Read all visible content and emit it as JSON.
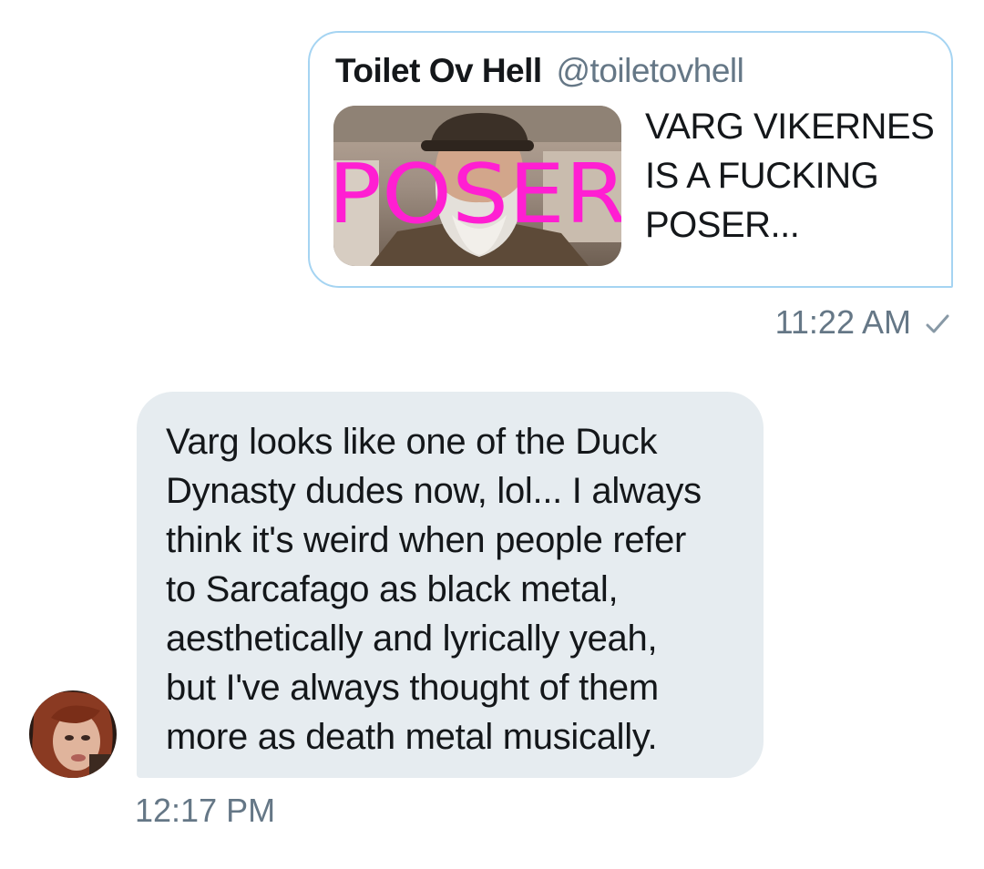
{
  "sent_message": {
    "tweet_card": {
      "author_name": "Toilet Ov Hell",
      "author_handle": "@toiletovhell",
      "thumbnail_overlay_text": "POSER",
      "text_lines": [
        "VARG VIKERNES",
        "IS A FUCKING",
        "POSER..."
      ]
    },
    "time": "11:22 AM",
    "status_icon": "checkmark-icon"
  },
  "received_message": {
    "lines": [
      "Varg looks like one of the Duck",
      "Dynasty dudes now, lol... I always",
      "think it's weird when people refer",
      "to Sarcafago as black metal,",
      "aesthetically and lyrically yeah,",
      "but I've always thought of them",
      "more as death metal musically."
    ],
    "time": "12:17 PM",
    "avatar_icon": "user-avatar"
  },
  "colors": {
    "card_border": "#a5d4f2",
    "bubble_bg": "#e6ecf0",
    "meta_text": "#657786",
    "poser_text": "#ff1fd2"
  }
}
